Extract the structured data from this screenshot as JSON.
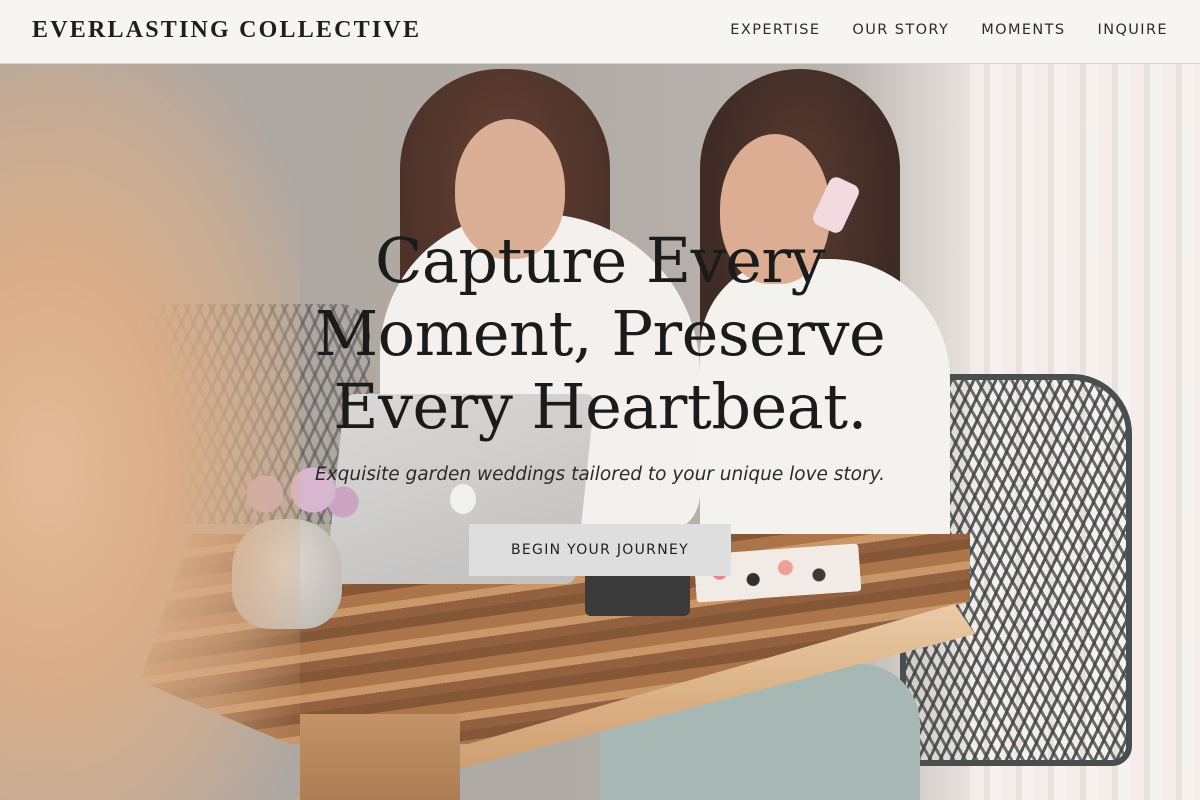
{
  "header": {
    "brand": "EVERLASTING COLLECTIVE",
    "nav": [
      {
        "label": "EXPERTISE"
      },
      {
        "label": "OUR STORY"
      },
      {
        "label": "MOMENTS"
      },
      {
        "label": "INQUIRE"
      }
    ]
  },
  "hero": {
    "headline": "Capture Every Moment, Preserve Every Heartbeat.",
    "subtitle": "Exquisite garden weddings tailored to your unique love story.",
    "cta_label": "BEGIN YOUR JOURNEY",
    "background_image": "two-women-planning-at-wooden-table-photo"
  },
  "colors": {
    "header_bg": "#f6f5f3",
    "text_dark": "#1b1b1b",
    "cta_bg": "#dedede"
  }
}
